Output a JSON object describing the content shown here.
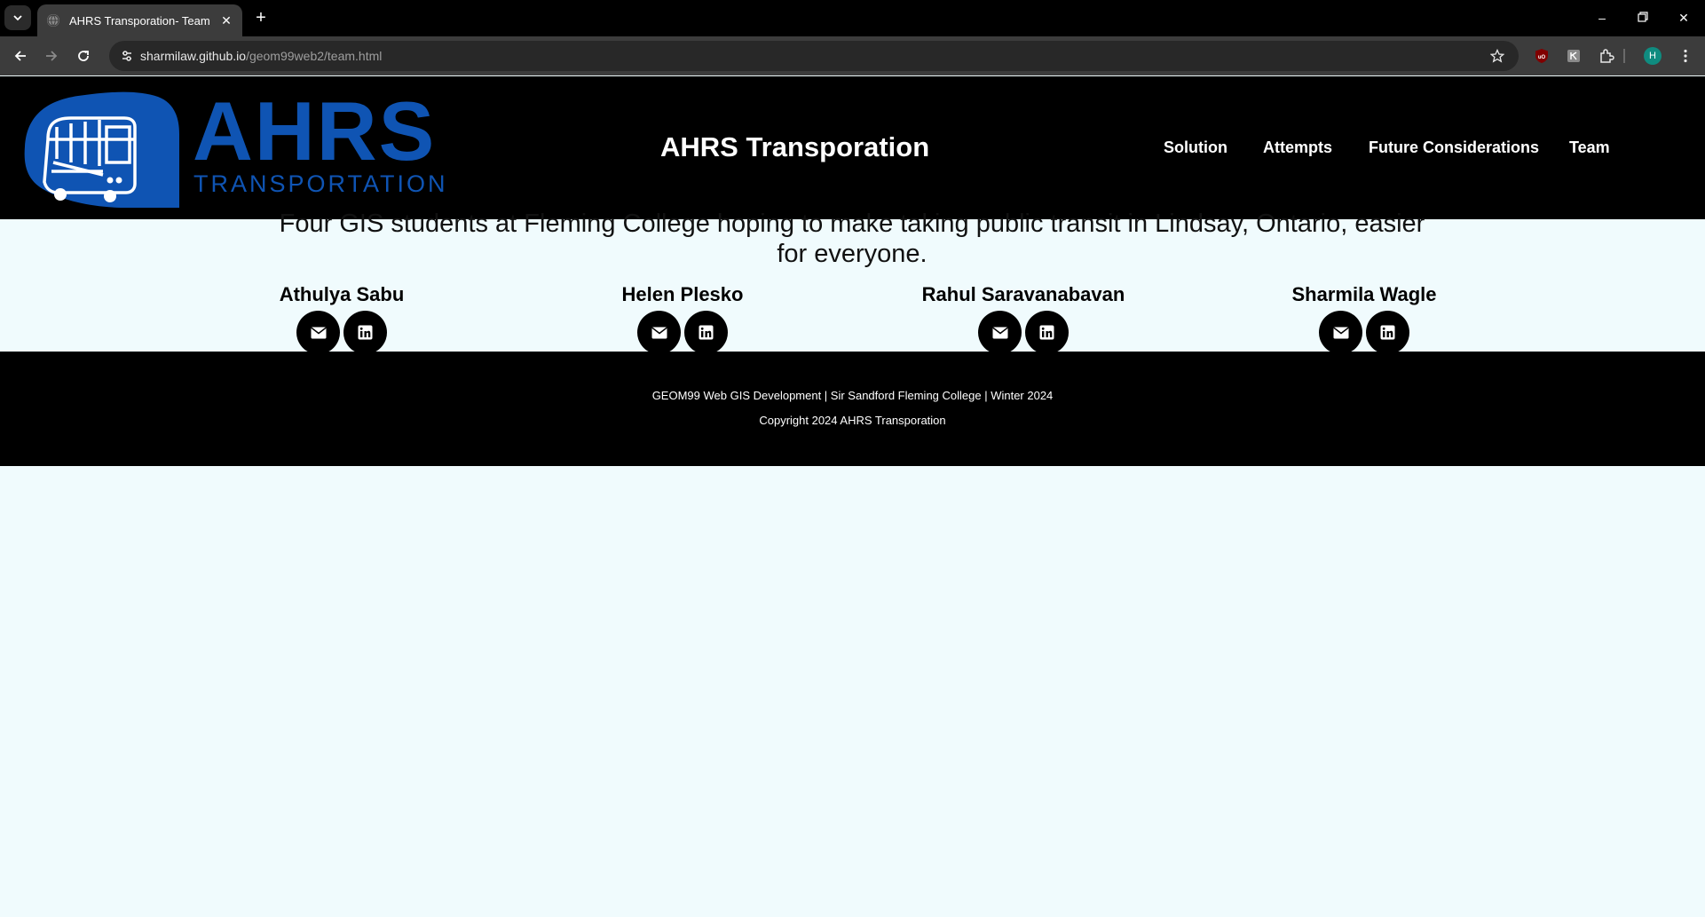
{
  "browser": {
    "tab_title": "AHRS Transporation- Team",
    "url_host": "sharmilaw.github.io",
    "url_path": "/geom99web2/team.html",
    "profile_initial": "H",
    "colors": {
      "tabbar": "#000000",
      "toolbar": "#3c3c3c",
      "omnibox": "#282828"
    }
  },
  "header": {
    "logo_big": "AHRS",
    "logo_small": "TRANSPORTATION",
    "site_title": "AHRS Transporation",
    "nav": [
      "Solution",
      "Attempts",
      "Future Considerations",
      "Team"
    ],
    "brand_color": "#0f54b3"
  },
  "main": {
    "tagline": "Four GIS students at Fleming College hoping to make taking public transit in Lindsay, Ontario, easier for everyone.",
    "members": [
      {
        "name": "Athulya Sabu"
      },
      {
        "name": "Helen Plesko"
      },
      {
        "name": "Rahul Saravanabavan"
      },
      {
        "name": "Sharmila Wagle"
      }
    ],
    "icons": [
      "envelope-icon",
      "linkedin-icon"
    ],
    "background": "#f0fbfd"
  },
  "footer": {
    "line1": "GEOM99 Web GIS Development | Sir Sandford Fleming College | Winter 2024",
    "line2": "Copyright 2024 AHRS Transporation"
  }
}
